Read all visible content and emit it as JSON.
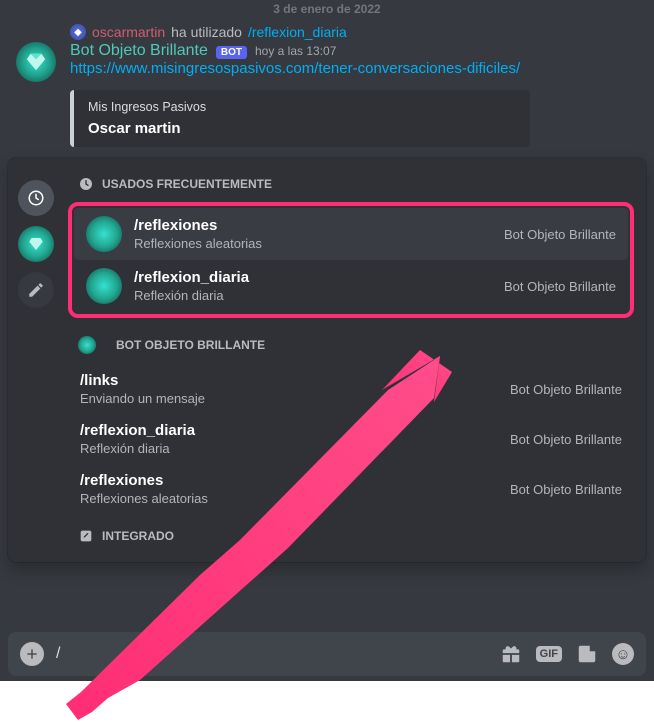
{
  "date_separator": "3 de enero de 2022",
  "reply": {
    "username": "oscarmartin",
    "action_text": "ha utilizado",
    "command": "/reflexion_diaria"
  },
  "message": {
    "bot_name": "Bot Objeto Brillante",
    "bot_badge": "BOT",
    "timestamp": "hoy a las 13:07",
    "link": "https://www.misingresospasivos.com/tener-conversaciones-dificiles/"
  },
  "embed": {
    "site": "Mis Ingresos Pasivos",
    "title": "Oscar martin"
  },
  "panel": {
    "sections": {
      "frequent": {
        "header": "USADOS FRECUENTEMENTE",
        "items": [
          {
            "cmd": "/reflexiones",
            "desc": "Reflexiones aleatorias",
            "source": "Bot Objeto Brillante"
          },
          {
            "cmd": "/reflexion_diaria",
            "desc": "Reflexión diaria",
            "source": "Bot Objeto Brillante"
          }
        ]
      },
      "bot": {
        "header": "BOT OBJETO BRILLANTE",
        "items": [
          {
            "cmd": "/links",
            "desc": "Enviando un mensaje",
            "source": "Bot Objeto Brillante"
          },
          {
            "cmd": "/reflexion_diaria",
            "desc": "Reflexión diaria",
            "source": "Bot Objeto Brillante"
          },
          {
            "cmd": "/reflexiones",
            "desc": "Reflexiones aleatorias",
            "source": "Bot Objeto Brillante"
          }
        ]
      },
      "integrated": {
        "header": "INTEGRADO"
      }
    }
  },
  "input": {
    "text": "/"
  }
}
